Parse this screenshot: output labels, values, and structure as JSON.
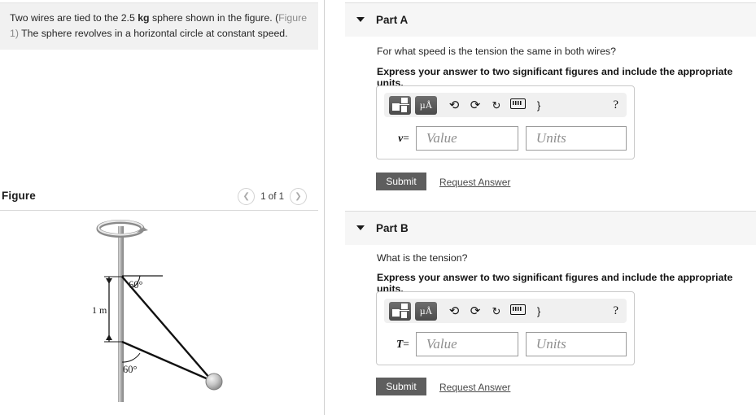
{
  "problem": {
    "text_before": "Two wires are tied to the 2.5 ",
    "unit_bold": "kg",
    "text_after": " sphere shown in the figure. (",
    "figure_ref": "Figure 1)",
    "text_end": " The sphere revolves in a horizontal circle at constant speed."
  },
  "figure": {
    "title": "Figure",
    "pager": {
      "prev_icon": "chevron-left-icon",
      "next_icon": "chevron-right-icon",
      "label": "1 of 1"
    },
    "diagram": {
      "length_label": "1 m",
      "angle_top_label": "60°",
      "angle_bottom_label": "60°"
    }
  },
  "parts": [
    {
      "id": "A",
      "title": "Part A",
      "caret_icon": "caret-down-icon",
      "question": "For what speed is the tension the same in both wires?",
      "instruction": "Express your answer to two significant figures and include the appropriate units.",
      "toolbar": {
        "template_icon": "math-template-icon",
        "unit_icon": "µÅ",
        "undo_icon": "undo-icon",
        "redo_icon": "redo-icon",
        "reset_icon": "reset-icon",
        "keyboard_icon": "keyboard-icon",
        "bracket_glyph": "}",
        "help_icon": "?"
      },
      "variable": "v",
      "equals": "=",
      "value_placeholder": "Value",
      "units_placeholder": "Units",
      "submit_label": "Submit",
      "request_label": "Request Answer"
    },
    {
      "id": "B",
      "title": "Part B",
      "caret_icon": "caret-down-icon",
      "question": "What is the tension?",
      "instruction": "Express your answer to two significant figures and include the appropriate units.",
      "toolbar": {
        "template_icon": "math-template-icon",
        "unit_icon": "µÅ",
        "undo_icon": "undo-icon",
        "redo_icon": "redo-icon",
        "reset_icon": "reset-icon",
        "keyboard_icon": "keyboard-icon",
        "bracket_glyph": "}",
        "help_icon": "?"
      },
      "variable": "T",
      "equals": "=",
      "value_placeholder": "Value",
      "units_placeholder": "Units",
      "submit_label": "Submit",
      "request_label": "Request Answer"
    }
  ],
  "colors": {
    "panel_bg": "#f1f1f1",
    "header_bg": "#f6f6f6",
    "submit_bg": "#5e5e5e",
    "link": "#4a4a4a"
  }
}
